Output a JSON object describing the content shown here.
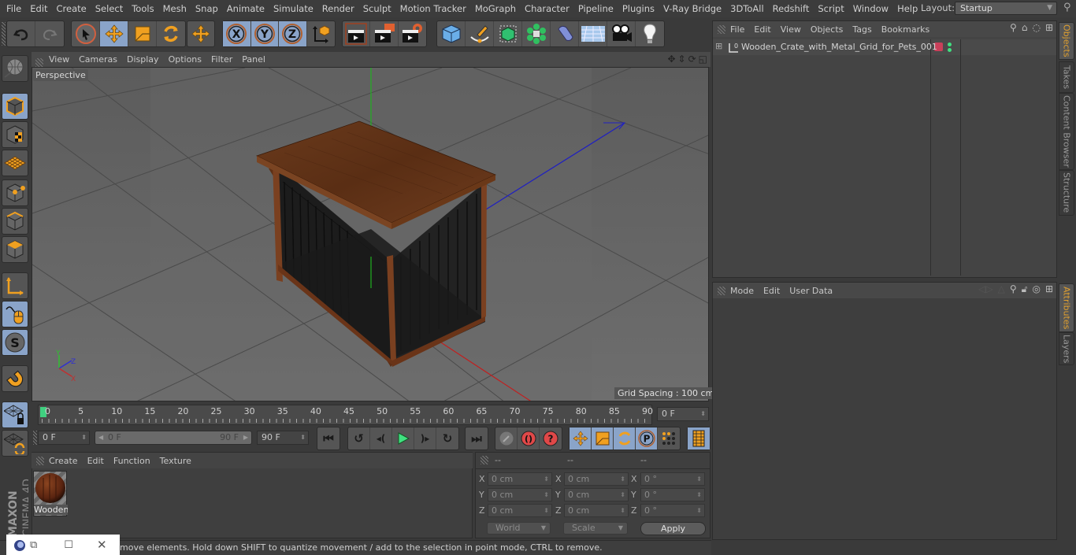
{
  "menubar": {
    "items": [
      "File",
      "Edit",
      "Create",
      "Select",
      "Tools",
      "Mesh",
      "Snap",
      "Animate",
      "Simulate",
      "Render",
      "Sculpt",
      "Motion Tracker",
      "MoGraph",
      "Character",
      "Pipeline",
      "Plugins",
      "V-Ray Bridge",
      "3DToAll",
      "Redshift",
      "Script",
      "Window",
      "Help"
    ],
    "layout_label": "Layout:",
    "layout_value": "Startup"
  },
  "toolbar": {
    "icons": [
      "undo-icon",
      "redo-icon",
      "live-selection-icon",
      "move-icon",
      "scale-icon",
      "rotate-icon",
      "last-tool-icon",
      "x-axis-icon",
      "y-axis-icon",
      "z-axis-icon",
      "coordinate-system-icon",
      "render-view-icon",
      "render-picture-viewer-icon",
      "render-settings-icon",
      "cube-icon",
      "pen-spline-icon",
      "subdivision-icon",
      "cloner-icon",
      "deformer-icon",
      "floor-icon",
      "camera-icon",
      "light-icon"
    ],
    "axis_labels": [
      "X",
      "Y",
      "Z"
    ]
  },
  "viewport": {
    "menu": [
      "View",
      "Cameras",
      "Display",
      "Options",
      "Filter",
      "Panel"
    ],
    "camera_label": "Perspective",
    "grid_spacing": "Grid Spacing : 100 cm",
    "axis_labels": {
      "x": "X",
      "y": "Y",
      "z": "Z"
    }
  },
  "left_tools": [
    "make-editable-icon",
    "model-mode-icon",
    "texture-mode-icon",
    "workplane-icon",
    "points-mode-icon",
    "edges-mode-icon",
    "polygons-mode-icon",
    "axis-mode-icon",
    "tweak-mode-icon",
    "solo-icon",
    "snap-icon",
    "workplane-lock-icon",
    "workplane-align-icon"
  ],
  "timeline": {
    "ticks": [
      "0",
      "5",
      "10",
      "15",
      "20",
      "25",
      "30",
      "35",
      "40",
      "45",
      "50",
      "55",
      "60",
      "65",
      "70",
      "75",
      "80",
      "85",
      "90"
    ],
    "current_frame": "0 F",
    "start_field": "0 F",
    "range_start": "0 F",
    "range_end": "90 F",
    "end_field": "90 F",
    "progress": 0
  },
  "materials": {
    "menu": [
      "Create",
      "Edit",
      "Function",
      "Texture"
    ],
    "items": [
      {
        "name": "Wooden"
      }
    ]
  },
  "coordinates": {
    "headers": [
      "--",
      "--",
      "--"
    ],
    "rows": [
      {
        "axis": "X",
        "pos": "0 cm",
        "size": "0 cm",
        "rot": "0 °"
      },
      {
        "axis": "Y",
        "pos": "0 cm",
        "size": "0 cm",
        "rot": "0 °"
      },
      {
        "axis": "Z",
        "pos": "0 cm",
        "size": "0 cm",
        "rot": "0 °"
      }
    ],
    "mode_select": "World",
    "scale_select": "Scale",
    "apply_label": "Apply"
  },
  "objects_panel": {
    "menu": [
      "File",
      "Edit",
      "View",
      "Objects",
      "Tags",
      "Bookmarks"
    ],
    "objects": [
      {
        "name": "Wooden_Crate_with_Metal_Grid_for_Pets_001",
        "layer_color": "#c8405a",
        "status_color": "#40e080"
      }
    ]
  },
  "attributes_panel": {
    "menu": [
      "Mode",
      "Edit",
      "User Data"
    ]
  },
  "side_tabs_top": [
    {
      "label": "Objects",
      "active": true
    },
    {
      "label": "Takes",
      "active": false
    },
    {
      "label": "Content Browser",
      "active": false
    },
    {
      "label": "Structure",
      "active": false
    }
  ],
  "side_tabs_bottom": [
    {
      "label": "Attributes",
      "active": true
    },
    {
      "label": "Layers",
      "active": false
    }
  ],
  "status": {
    "text": "move elements. Hold down SHIFT to quantize movement / add to the selection in point mode, CTRL to remove."
  },
  "brand": {
    "line1": "MAXON",
    "line2": "CINEMA 4D"
  },
  "colors": {
    "accent_blue": "#8aa4c9",
    "icon_orange": "#f0a020",
    "active_tab": "#e0a030"
  }
}
